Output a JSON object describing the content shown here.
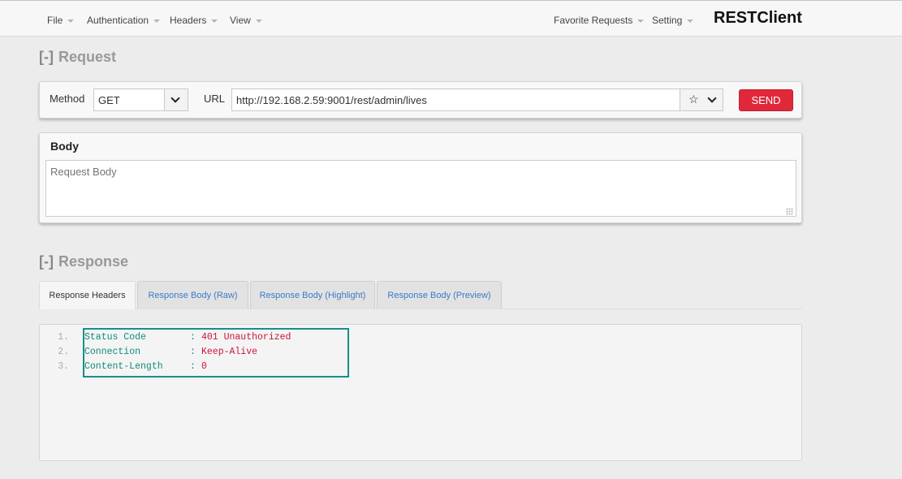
{
  "app": {
    "brand": "RESTClient"
  },
  "menu": {
    "left": [
      "File",
      "Authentication",
      "Headers",
      "View"
    ],
    "right": [
      "Favorite Requests",
      "Setting"
    ]
  },
  "request": {
    "section_toggle": "[-]",
    "section_title": "Request",
    "method_label": "Method",
    "method_value": "GET",
    "url_label": "URL",
    "url_value": "http://192.168.2.59:9001/rest/admin/lives",
    "star_icon": "☆",
    "send_label": "SEND",
    "body_label": "Body",
    "body_placeholder": "Request Body"
  },
  "response": {
    "section_toggle": "[-]",
    "section_title": "Response",
    "tabs": [
      "Response Headers",
      "Response Body (Raw)",
      "Response Body (Highlight)",
      "Response Body (Preview)"
    ],
    "active_tab": "Response Headers",
    "headers": [
      {
        "num": "1.",
        "key": "Status Code",
        "value": "401 Unauthorized"
      },
      {
        "num": "2.",
        "key": "Connection",
        "value": "Keep-Alive"
      },
      {
        "num": "3.",
        "key": "Content-Length",
        "value": "0"
      }
    ]
  },
  "colors": {
    "send_button": "#e0283a",
    "header_key": "#0d8b7a",
    "header_value": "#c8153a",
    "highlight_border": "#168f8a",
    "tab_link": "#3a7bc8"
  }
}
